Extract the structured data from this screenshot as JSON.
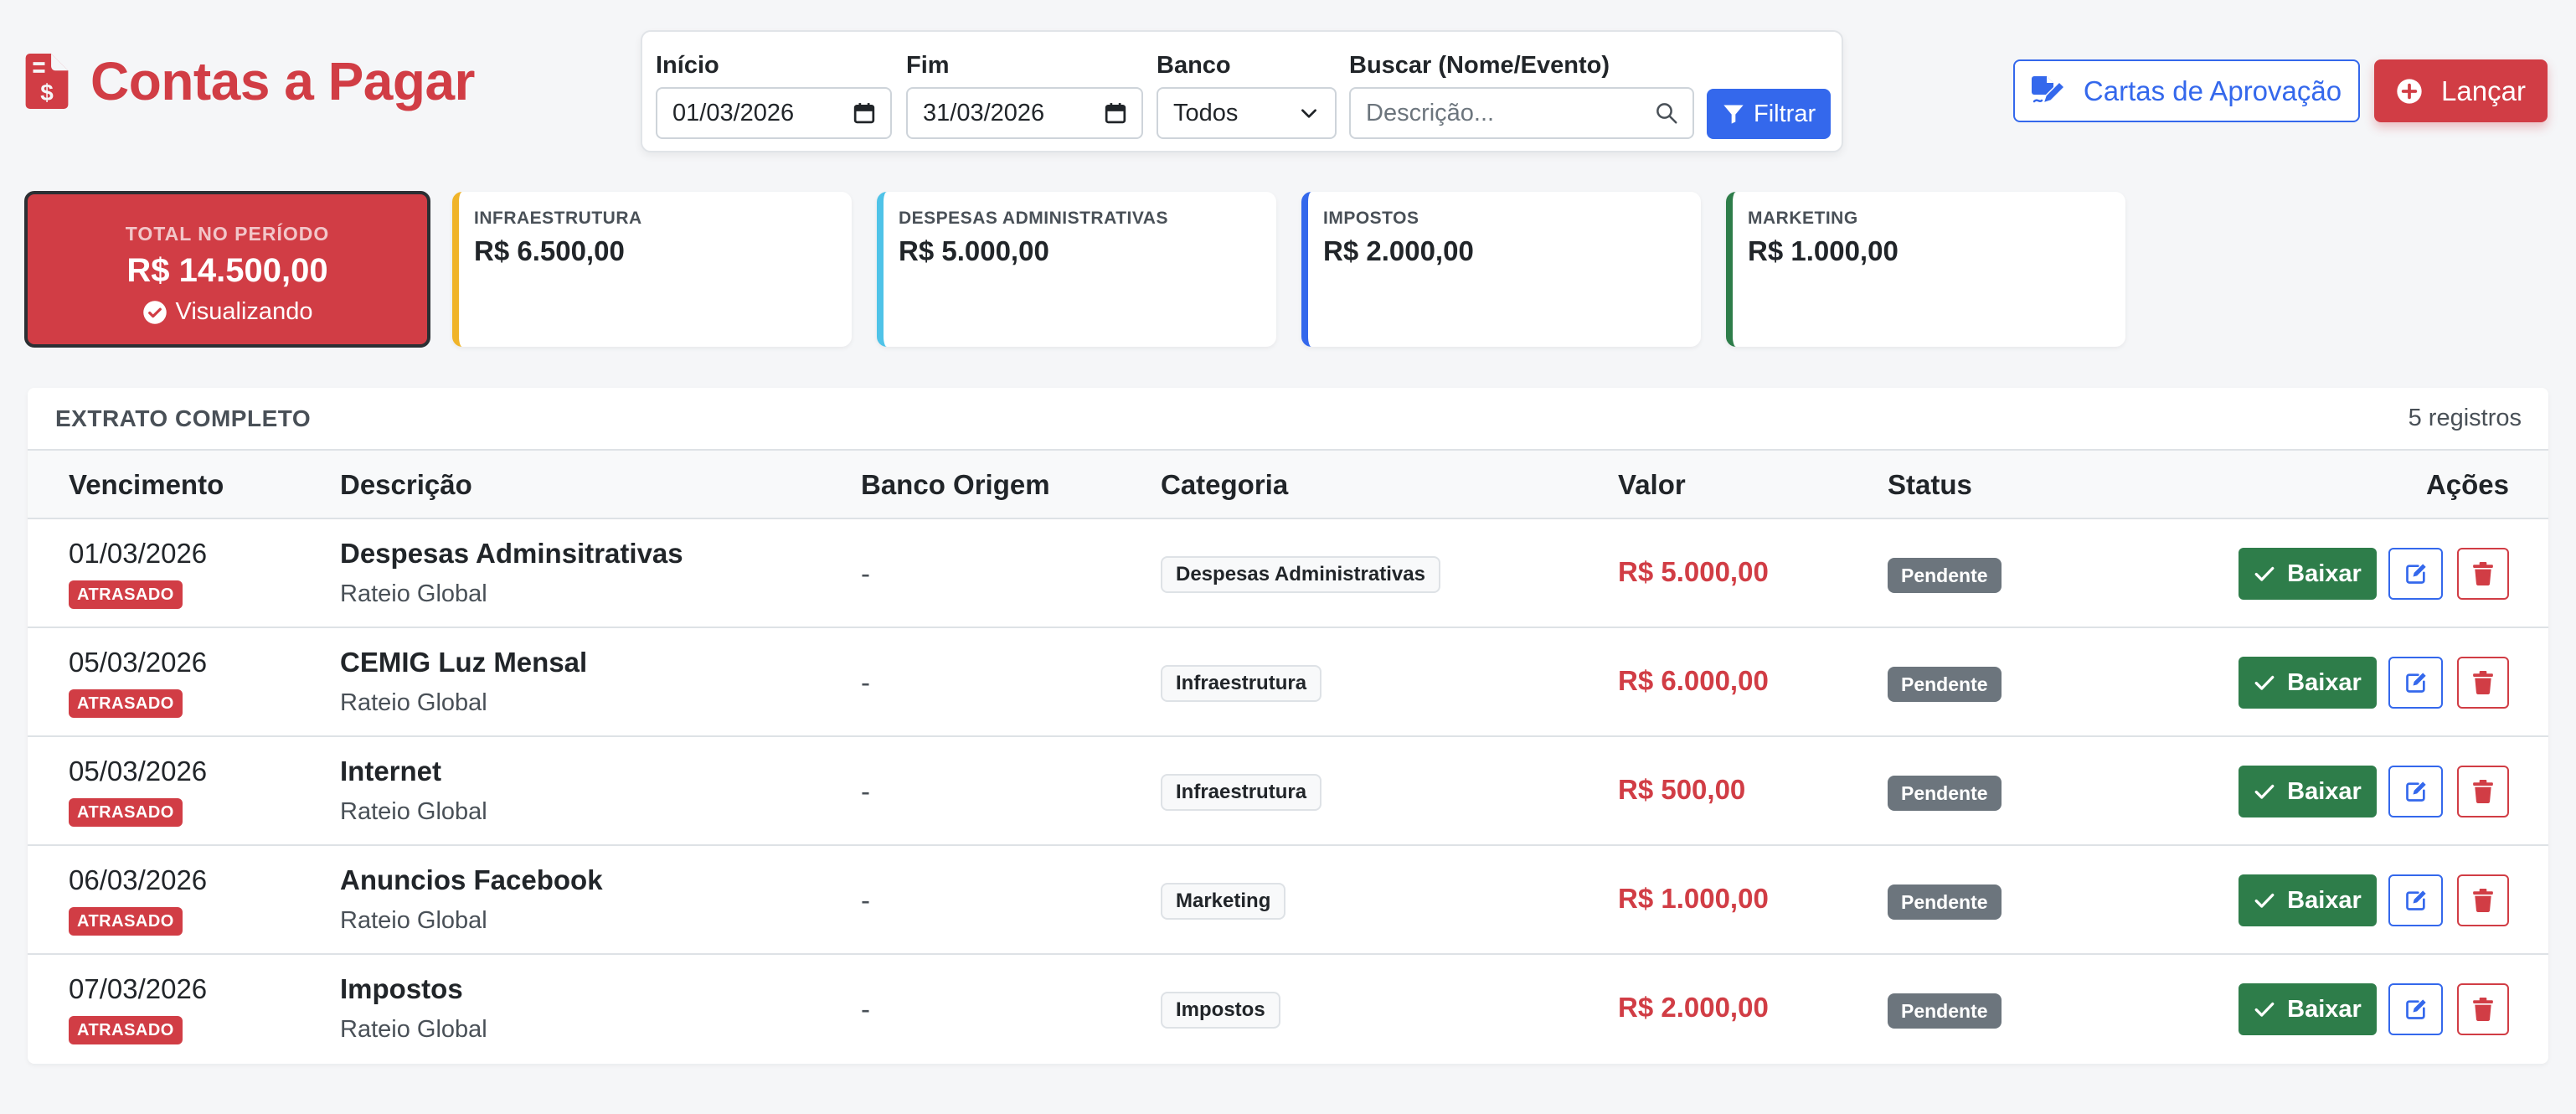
{
  "header": {
    "title": "Contas a Pagar"
  },
  "filters": {
    "inicio": {
      "label": "Início",
      "value": "01/03/2026"
    },
    "fim": {
      "label": "Fim",
      "value": "31/03/2026"
    },
    "banco": {
      "label": "Banco",
      "value": "Todos"
    },
    "buscar": {
      "label": "Buscar (Nome/Evento)",
      "placeholder": "Descrição..."
    },
    "filtrar_label": "Filtrar"
  },
  "actions": {
    "cartas_label": "Cartas de Aprovação",
    "lancar_label": "Lançar"
  },
  "summary": {
    "total": {
      "label": "TOTAL NO PERÍODO",
      "value": "R$ 14.500,00",
      "viewing": "Visualizando"
    },
    "cards": [
      {
        "label": "INFRAESTRUTURA",
        "value": "R$ 6.500,00",
        "color": "#f0b429"
      },
      {
        "label": "DESPESAS ADMINISTRATIVAS",
        "value": "R$ 5.000,00",
        "color": "#4fc3e8"
      },
      {
        "label": "IMPOSTOS",
        "value": "R$ 2.000,00",
        "color": "#3468ec"
      },
      {
        "label": "MARKETING",
        "value": "R$ 1.000,00",
        "color": "#2e7d4a"
      }
    ]
  },
  "table": {
    "title": "EXTRATO COMPLETO",
    "count": "5 registros",
    "columns": {
      "vencimento": "Vencimento",
      "descricao": "Descrição",
      "banco": "Banco Origem",
      "categoria": "Categoria",
      "valor": "Valor",
      "status": "Status",
      "acoes": "Ações"
    },
    "rows": [
      {
        "date": "01/03/2026",
        "late": "ATRASADO",
        "desc": "Despesas Adminsitrativas",
        "sub": "Rateio Global",
        "bank": "-",
        "category": "Despesas Administrativas",
        "value": "R$ 5.000,00",
        "status": "Pendente",
        "baixar": "Baixar"
      },
      {
        "date": "05/03/2026",
        "late": "ATRASADO",
        "desc": "CEMIG Luz Mensal",
        "sub": "Rateio Global",
        "bank": "-",
        "category": "Infraestrutura",
        "value": "R$ 6.000,00",
        "status": "Pendente",
        "baixar": "Baixar"
      },
      {
        "date": "05/03/2026",
        "late": "ATRASADO",
        "desc": "Internet",
        "sub": "Rateio Global",
        "bank": "-",
        "category": "Infraestrutura",
        "value": "R$ 500,00",
        "status": "Pendente",
        "baixar": "Baixar"
      },
      {
        "date": "06/03/2026",
        "late": "ATRASADO",
        "desc": "Anuncios Facebook",
        "sub": "Rateio Global",
        "bank": "-",
        "category": "Marketing",
        "value": "R$ 1.000,00",
        "status": "Pendente",
        "baixar": "Baixar"
      },
      {
        "date": "07/03/2026",
        "late": "ATRASADO",
        "desc": "Impostos",
        "sub": "Rateio Global",
        "bank": "-",
        "category": "Impostos",
        "value": "R$ 2.000,00",
        "status": "Pendente",
        "baixar": "Baixar"
      }
    ]
  },
  "colors": {
    "danger": "#d13d45",
    "primary": "#3468ec",
    "success": "#2e7d4a",
    "secondary": "#6c757d"
  }
}
